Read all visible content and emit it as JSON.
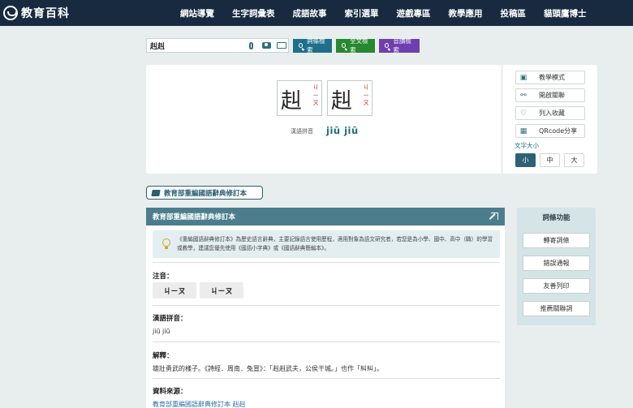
{
  "nav": {
    "logo_text": "教育百科",
    "items": [
      "網站導覽",
      "生字詞彙表",
      "成語故事",
      "索引選單",
      "遊戲專區",
      "教學應用",
      "投稿區",
      "貓頭鷹博士"
    ]
  },
  "search": {
    "value": "赳赳",
    "buttons": {
      "word": "詞條檢索",
      "fulltext": "全文檢索",
      "sound": "音讀檢索"
    }
  },
  "word": {
    "chars": [
      {
        "char": "赳",
        "zhuyin": [
          "ㄐ",
          "ㄧ",
          "ㄡ"
        ]
      },
      {
        "char": "赳",
        "zhuyin": [
          "ㄐ",
          "ㄧ",
          "ㄡ"
        ]
      }
    ],
    "pinyin_label": "漢語拼音",
    "pinyin": "jiū jiū",
    "side_buttons": [
      "教學模式",
      "開啟關聯",
      "列入收藏",
      "QRcode分享"
    ],
    "font_size_label": "文字大小",
    "font_sizes": [
      "小",
      "中",
      "大"
    ]
  },
  "dict_tag": "教育部重編國語辭典修訂本",
  "panel": {
    "title": "教育部重編國語辭典修訂本",
    "notice": "《重編國語辭典修訂本》為歷史語言辭典，主要記錄語言使用歷程，適用對象為語文研究者，若您是為小學、國中、高中（職）的學習或教學，建議您優先使用《國語小字典》或《國語辭典簡編本》。",
    "zhuyin_label": "注音：",
    "zhuyin_chips": [
      "ㄐㄧㄡ",
      "ㄐㄧㄡ"
    ],
    "pinyin_label": "漢語拼音：",
    "pinyin_value": "jiū jiū",
    "def_label": "解釋：",
    "def_text": "雄壯勇武的樣子。《詩經．周南．兔罝》：「赳赳武夫，公侯干城。」也作「糾糾」。",
    "source_label": "資料來源：",
    "source_link": "教育部重編國語辭典修訂本 赳赳"
  },
  "functions": {
    "title": "詞條功能",
    "buttons": [
      "轉寄詞條",
      "錯誤通報",
      "友善列印",
      "推薦關聯詞"
    ]
  }
}
